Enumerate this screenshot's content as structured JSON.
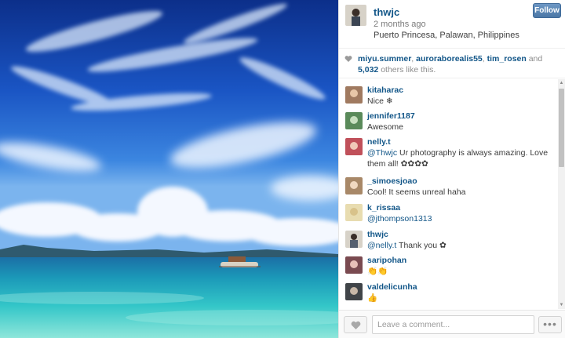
{
  "post": {
    "username": "thwjc",
    "time": "2 months ago",
    "location": "Puerto Princesa, Palawan, Philippines",
    "follow_label": "Follow"
  },
  "likes": {
    "users": [
      "miyu.summer",
      "auroraborealis55",
      "tim_rosen"
    ],
    "and_text": "and",
    "count": "5,032",
    "suffix": "others like this."
  },
  "comments": [
    {
      "user": "kitaharac",
      "text": "Nice ❄",
      "avatar_color": "#a07a60"
    },
    {
      "user": "jennifer1187",
      "text": "Awesome",
      "avatar_color": "#5a8a5a"
    },
    {
      "user": "nelly.t",
      "mention": "@Thwjc",
      "text": " Ur photography is always amazing. Love them all! ✿✿✿✿",
      "avatar_color": "#c0505a"
    },
    {
      "user": "_simoesjoao",
      "text": "Cool! It seems unreal haha",
      "avatar_color": "#a88868"
    },
    {
      "user": "k_rissaa",
      "mention": "@jthompson1313",
      "text": "",
      "avatar_color": "#d8c28a"
    },
    {
      "user": "thwjc",
      "mention": "@nelly.t",
      "text": " Thank you ✿",
      "avatar_color": "#556070"
    },
    {
      "user": "saripohan",
      "text": "👏👏",
      "avatar_color": "#7a4a50"
    },
    {
      "user": "valdelicunha",
      "text": "👍",
      "avatar_color": "#404448"
    }
  ],
  "footer": {
    "comment_placeholder": "Leave a comment...",
    "more_label": "•••"
  },
  "icons": {
    "heart": "heart-icon",
    "like": "heart-icon",
    "more": "ellipsis-icon"
  },
  "colors": {
    "username": "#125688",
    "follow_button": "#517fa4"
  }
}
